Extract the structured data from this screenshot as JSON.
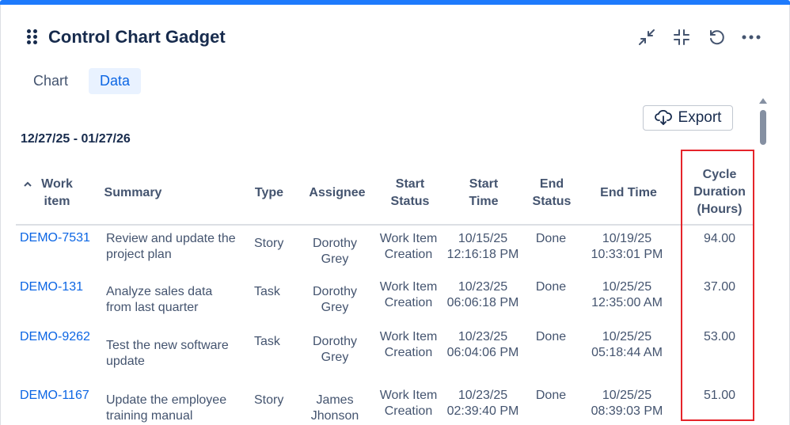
{
  "gadget": {
    "title": "Control Chart Gadget",
    "icons": [
      "drag-handle-icon",
      "collapse-icon",
      "shrink-icon",
      "refresh-icon",
      "more-icon"
    ]
  },
  "tabs": [
    {
      "label": "Chart",
      "active": false
    },
    {
      "label": "Data",
      "active": true
    }
  ],
  "export_label": "Export",
  "date_range": "12/27/25 - 01/27/26",
  "columns": {
    "work_item": [
      "Work",
      "item"
    ],
    "summary": "Summary",
    "type": "Type",
    "assignee": "Assignee",
    "start_status": [
      "Start",
      "Status"
    ],
    "start_time": [
      "Start",
      "Time"
    ],
    "end_status": [
      "End",
      "Status"
    ],
    "end_time": "End Time",
    "cycle": [
      "Cycle",
      "Duration",
      "(Hours)"
    ]
  },
  "rows": [
    {
      "key": "DEMO-7531",
      "summary": [
        "Review and update the",
        "project plan"
      ],
      "type": "Story",
      "assignee": [
        "Dorothy",
        "Grey"
      ],
      "start_status": [
        "Work Item",
        "Creation"
      ],
      "start_time": [
        "10/15/25",
        "12:16:18 PM"
      ],
      "end_status": "Done",
      "end_time": [
        "10/19/25",
        "10:33:01 PM"
      ],
      "cycle": "94.00"
    },
    {
      "key": "DEMO-131",
      "summary": [
        "Analyze sales data",
        "from last quarter"
      ],
      "type": "Task",
      "assignee": [
        "Dorothy",
        "Grey"
      ],
      "start_status": [
        "Work Item",
        "Creation"
      ],
      "start_time": [
        "10/23/25",
        "06:06:18 PM"
      ],
      "end_status": "Done",
      "end_time": [
        "10/25/25",
        "12:35:00 AM"
      ],
      "cycle": "37.00"
    },
    {
      "key": "DEMO-9262",
      "summary": [
        "Test the new software",
        "update"
      ],
      "type": "Task",
      "assignee": [
        "Dorothy",
        "Grey"
      ],
      "start_status": [
        "Work Item",
        "Creation"
      ],
      "start_time": [
        "10/23/25",
        "06:04:06 PM"
      ],
      "end_status": "Done",
      "end_time": [
        "10/25/25",
        "05:18:44 AM"
      ],
      "cycle": "53.00"
    },
    {
      "key": "DEMO-1167",
      "summary": [
        "Update the employee",
        "training manual"
      ],
      "type": "Story",
      "assignee": [
        "James",
        "Jhonson"
      ],
      "start_status": [
        "Work Item",
        "Creation"
      ],
      "start_time": [
        "10/23/25",
        "02:39:40 PM"
      ],
      "end_status": "Done",
      "end_time": [
        "10/25/25",
        "08:39:03 PM"
      ],
      "cycle": "51.00"
    }
  ]
}
